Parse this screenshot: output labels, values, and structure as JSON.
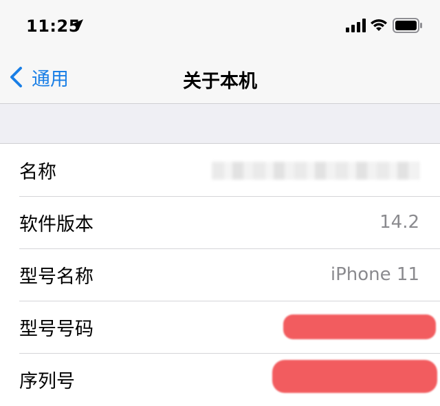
{
  "status_bar": {
    "time": "11:25",
    "icons": [
      "location-arrow-icon",
      "cellular-signal-icon",
      "wifi-icon",
      "battery-icon"
    ]
  },
  "nav": {
    "back_label": "通用",
    "title": "关于本机"
  },
  "rows": [
    {
      "label": "名称",
      "value": ""
    },
    {
      "label": "软件版本",
      "value": "14.2"
    },
    {
      "label": "型号名称",
      "value": "iPhone 11"
    },
    {
      "label": "型号号码",
      "value": ""
    },
    {
      "label": "序列号",
      "value": ""
    }
  ],
  "colors": {
    "accent": "#1a7fe6",
    "value_text": "#8a8a8e",
    "grouped_background": "#efeff4",
    "redaction_red": "#f25c5f"
  }
}
